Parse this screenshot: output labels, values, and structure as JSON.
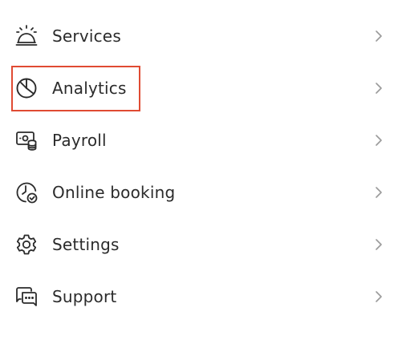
{
  "menu": {
    "items": [
      {
        "label": "Services",
        "icon": "service-bell-icon"
      },
      {
        "label": "Analytics",
        "icon": "pie-chart-icon"
      },
      {
        "label": "Payroll",
        "icon": "payroll-icon"
      },
      {
        "label": "Online booking",
        "icon": "clock-check-icon"
      },
      {
        "label": "Settings",
        "icon": "gear-icon"
      },
      {
        "label": "Support",
        "icon": "chat-bubbles-icon"
      }
    ],
    "highlighted_item": "Analytics"
  },
  "colors": {
    "text": "#2b2b2b",
    "chevron": "#9a9a9a",
    "highlight": "#e04b33",
    "background": "#ffffff"
  }
}
